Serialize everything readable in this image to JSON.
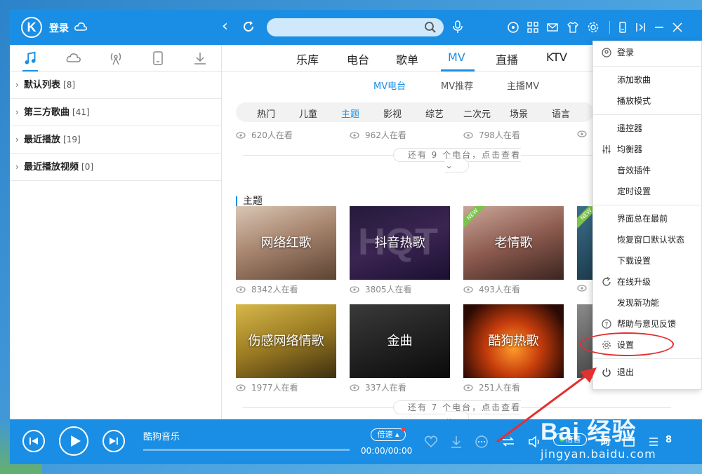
{
  "app": {
    "login_label": "登录",
    "search_placeholder": ""
  },
  "left_tabs": [
    "music-note-icon",
    "cloud-icon",
    "radio-icon",
    "device-icon",
    "download-icon"
  ],
  "left_list": [
    {
      "name": "默认列表",
      "count": "[8]"
    },
    {
      "name": "第三方歌曲",
      "count": "[41]"
    },
    {
      "name": "最近播放",
      "count": "[19]"
    },
    {
      "name": "最近播放视频",
      "count": "[0]"
    }
  ],
  "top_tabs": {
    "t0": "乐库",
    "t1": "电台",
    "t2": "歌单",
    "t3": "MV",
    "t4": "直播",
    "t5": "KTV"
  },
  "sub_tabs": {
    "s0": "MV电台",
    "s1": "MV推荐",
    "s2": "主播MV"
  },
  "categories": {
    "c0": "热门",
    "c1": "儿童",
    "c2": "主题",
    "c3": "影视",
    "c4": "综艺",
    "c5": "二次元",
    "c6": "场景",
    "c7": "语言"
  },
  "top_row_viewers": {
    "v0": "620人在看",
    "v1": "962人在看",
    "v2": "798人在看"
  },
  "more_top": "还有 9 个电台，点击查看",
  "section_title": "主题",
  "cards_row1": [
    {
      "title": "网络红歌",
      "viewers": "8342人在看"
    },
    {
      "title": "抖音热歌",
      "viewers": "3805人在看"
    },
    {
      "title": "老情歌",
      "viewers": "493人在看",
      "badge": "NEW"
    }
  ],
  "card4_badge": "NEW",
  "cards_row2": [
    {
      "title": "伤感网络情歌",
      "viewers": "1977人在看"
    },
    {
      "title": "金曲",
      "viewers": "337人在看"
    },
    {
      "title": "酷狗热歌",
      "viewers": "251人在看"
    }
  ],
  "more_bottom": "还有 7 个电台，点击查看",
  "player": {
    "song": "酷狗音乐",
    "speed": "倍速",
    "time": "00:00/00:00",
    "quality": "倍音",
    "lyric": "词",
    "count": "8",
    "progress": 0
  },
  "menu": {
    "login": "登录",
    "add_song": "添加歌曲",
    "play_mode": "播放模式",
    "remote": "遥控器",
    "equalizer": "均衡器",
    "sound_plugin": "音效插件",
    "timer": "定时设置",
    "always_on_top": "界面总在最前",
    "restore_window": "恢复窗口默认状态",
    "download_settings": "下载设置",
    "online_upgrade": "在线升级",
    "new_features": "发现新功能",
    "help_feedback": "帮助与意见反馈",
    "settings": "设置",
    "exit": "退出"
  },
  "watermark": {
    "logo": "Bai 经验",
    "url": "jingyan.baidu.com"
  },
  "colors": {
    "brand": "#1a8ee4",
    "annotation": "#e33030"
  }
}
